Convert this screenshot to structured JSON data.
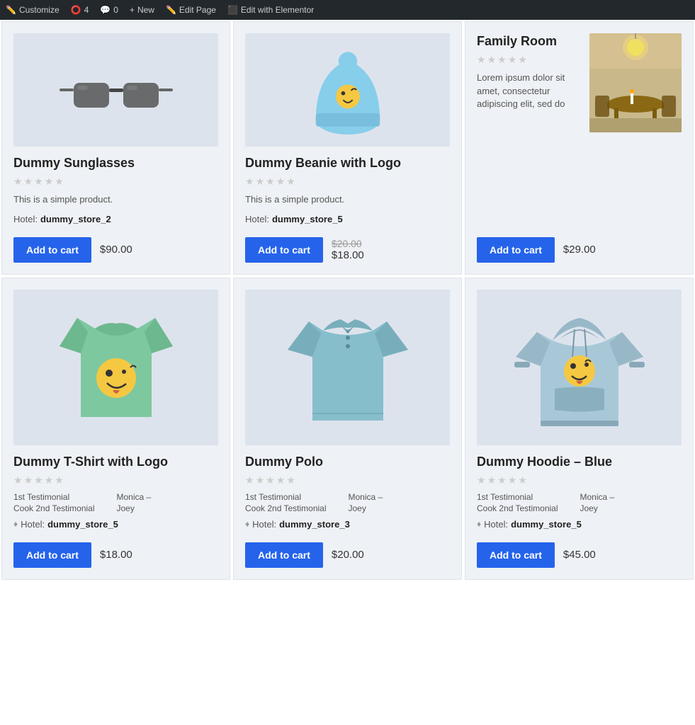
{
  "admin_bar": {
    "items": [
      {
        "label": "Customize",
        "icon": "✏",
        "name": "customize"
      },
      {
        "label": "4",
        "icon": "⭕",
        "name": "revisions"
      },
      {
        "label": "0",
        "icon": "💬",
        "name": "comments"
      },
      {
        "label": "New",
        "icon": "+",
        "name": "new"
      },
      {
        "label": "Edit Page",
        "icon": "✏",
        "name": "edit-page"
      },
      {
        "label": "Edit with Elementor",
        "icon": "⬛",
        "name": "elementor"
      }
    ]
  },
  "products": [
    {
      "id": "dummy-sunglasses",
      "title": "Dummy Sunglasses",
      "description": "This is a simple product.",
      "hotel_label": "Hotel:",
      "hotel_name": "dummy_store_2",
      "price": "$90.00",
      "price_struck": null,
      "price_sale": null,
      "rating": 0,
      "type": "simple",
      "testimonials": null,
      "add_to_cart": "Add to cart"
    },
    {
      "id": "dummy-beanie",
      "title": "Dummy Beanie with Logo",
      "description": "This is a simple product.",
      "hotel_label": "Hotel:",
      "hotel_name": "dummy_store_5",
      "price": "$18.00",
      "price_struck": "$20.00",
      "price_sale": "$18.00",
      "rating": 0,
      "type": "simple",
      "testimonials": null,
      "add_to_cart": "Add to cart"
    },
    {
      "id": "family-room",
      "title": "Family Room",
      "description": "Lorem ipsum dolor sit amet, consectetur adipiscing elit, sed do",
      "hotel_label": null,
      "hotel_name": null,
      "price": "$29.00",
      "price_struck": null,
      "price_sale": null,
      "rating": 0,
      "type": "horizontal",
      "testimonials": null,
      "add_to_cart": "Add to cart"
    },
    {
      "id": "dummy-tshirt",
      "title": "Dummy T-Shirt with Logo",
      "description": null,
      "hotel_label": "Hotel:",
      "hotel_name": "dummy_store_5",
      "price": "$18.00",
      "price_struck": null,
      "price_sale": null,
      "rating": 0,
      "type": "testimonial",
      "testimonials": [
        {
          "col1": "1st Testimonial",
          "col2": "Monica –"
        },
        {
          "col1": "Cook 2nd Testimonial",
          "col2": "Joey"
        }
      ],
      "add_to_cart": "Add to cart"
    },
    {
      "id": "dummy-polo",
      "title": "Dummy Polo",
      "description": null,
      "hotel_label": "Hotel:",
      "hotel_name": "dummy_store_3",
      "price": "$20.00",
      "price_struck": null,
      "price_sale": null,
      "rating": 0,
      "type": "testimonial",
      "testimonials": [
        {
          "col1": "1st Testimonial",
          "col2": "Monica –"
        },
        {
          "col1": "Cook 2nd Testimonial",
          "col2": "Joey"
        }
      ],
      "add_to_cart": "Add to cart"
    },
    {
      "id": "dummy-hoodie-blue",
      "title": "Dummy Hoodie – Blue",
      "description": null,
      "hotel_label": "Hotel:",
      "hotel_name": "dummy_store_5",
      "price": "$45.00",
      "price_struck": null,
      "price_sale": null,
      "rating": 0,
      "type": "testimonial",
      "testimonials": [
        {
          "col1": "1st Testimonial",
          "col2": "Monica –"
        },
        {
          "col1": "Cook 2nd Testimonial",
          "col2": "Joey"
        }
      ],
      "add_to_cart": "Add to cart"
    }
  ]
}
